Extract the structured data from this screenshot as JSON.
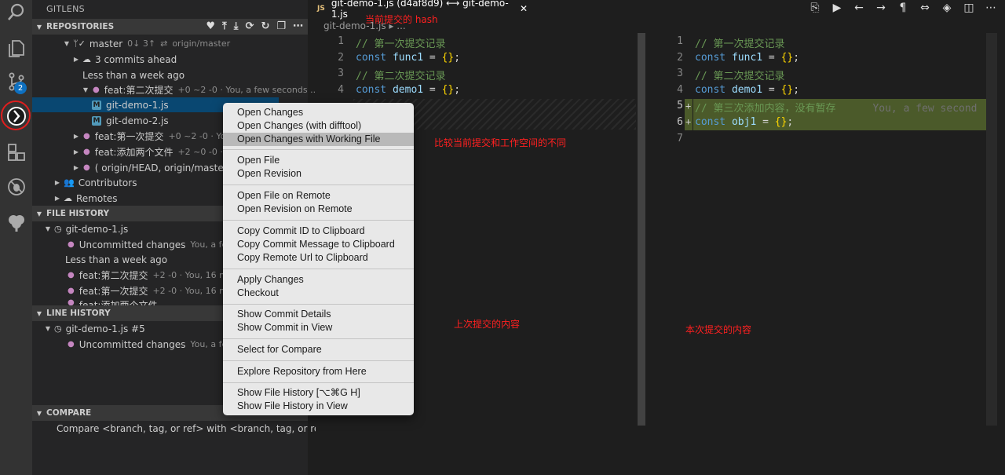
{
  "activity": {
    "items": [
      "search-icon",
      "files-icon",
      "source-control-icon",
      "gitlens-icon",
      "extensions-icon",
      "debug-icon",
      "tree-icon"
    ],
    "scm_badge": "2"
  },
  "sidebar": {
    "title": "GITLENS",
    "repositories": {
      "header": "REPOSITORIES",
      "rows": {
        "branch": "master",
        "branch_status": "0↓ 3↑",
        "branch_upstream": "origin/master",
        "ahead": "3 commits ahead",
        "time_group": "Less than a week ago",
        "commit1": "feat:第二次提交",
        "commit1_desc": "+0 ~2 -0 · You, a few seconds ...",
        "file1": "git-demo-1.js",
        "file2": "git-demo-2.js",
        "commit2": "feat:第一次提交",
        "commit2_desc": "+0 ~2 -0 · Yo",
        "commit3": "feat:添加两个文件",
        "commit3_desc": "+2 ~0 -0 ·",
        "commit4": "( origin/HEAD, origin/master",
        "contributors": "Contributors",
        "remotes": "Remotes"
      }
    },
    "file_history": {
      "header": "FILE HISTORY",
      "file": "git-demo-1.js",
      "uncommitted": "Uncommitted changes",
      "uncommitted_desc": "You, a few",
      "time_group": "Less than a week ago",
      "c1": "feat:第二次提交",
      "c1_desc": "+2 -0 · You, 16 m",
      "c2": "feat:第一次提交",
      "c2_desc": "+2 -0 · You, 16 m",
      "c3": "feat:添加两个文件"
    },
    "line_history": {
      "header": "LINE HISTORY",
      "file": "git-demo-1.js #5",
      "uncommitted": "Uncommitted changes",
      "uncommitted_desc": "You, a few"
    },
    "compare": {
      "header": "COMPARE",
      "text": "Compare <branch, tag, or ref> with <branch, tag, or ref>"
    }
  },
  "editor": {
    "tab_title": "git-demo-1.js (d4af8d9) ⟷ git-demo-1.js",
    "tab_js": "JS",
    "breadcrumb": "git-demo-1.js ▸ ...",
    "left_lines": [
      {
        "n": "1",
        "comment": "// 第一次提交记录"
      },
      {
        "n": "2",
        "kw": "const",
        "id": "func1",
        "rest": " = ",
        "br": "{}",
        "end": ";"
      },
      {
        "n": "3",
        "comment": "// 第二次提交记录"
      },
      {
        "n": "4",
        "kw": "const",
        "id": "demo1",
        "rest": " = ",
        "br": "{}",
        "end": ";"
      }
    ],
    "right_lines": [
      {
        "n": "1",
        "comment": "// 第一次提交记录"
      },
      {
        "n": "2",
        "kw": "const",
        "id": "func1",
        "rest": " = ",
        "br": "{}",
        "end": ";"
      },
      {
        "n": "3",
        "comment": "// 第二次提交记录"
      },
      {
        "n": "4",
        "kw": "const",
        "id": "demo1",
        "rest": " = ",
        "br": "{}",
        "end": ";"
      },
      {
        "n": "5",
        "comment": "// 第三次添加内容，没有暂存",
        "ghost": "You, a few second"
      },
      {
        "n": "6",
        "kw": "const",
        "id": "obj1",
        "rest": " = ",
        "br": "{}",
        "end": ";"
      },
      {
        "n": "7"
      }
    ]
  },
  "context_menu": {
    "items": [
      "Open Changes",
      "Open Changes (with difftool)",
      "Open Changes with Working File",
      "Open File",
      "Open Revision",
      "Open File on Remote",
      "Open Revision on Remote",
      "Copy Commit ID to Clipboard",
      "Copy Commit Message to Clipboard",
      "Copy Remote Url to Clipboard",
      "Apply Changes",
      "Checkout",
      "Show Commit Details",
      "Show Commit in View",
      "Select for Compare",
      "Explore Repository from Here",
      "Show File History [⌥⌘G H]",
      "Show File History in View"
    ],
    "highlighted_index": 2
  },
  "annotations": {
    "hash": "当前提交的 hash",
    "compare": "比较当前提交和工作空间的不同",
    "previous": "上次提交的内容",
    "current": "本次提交的内容"
  }
}
